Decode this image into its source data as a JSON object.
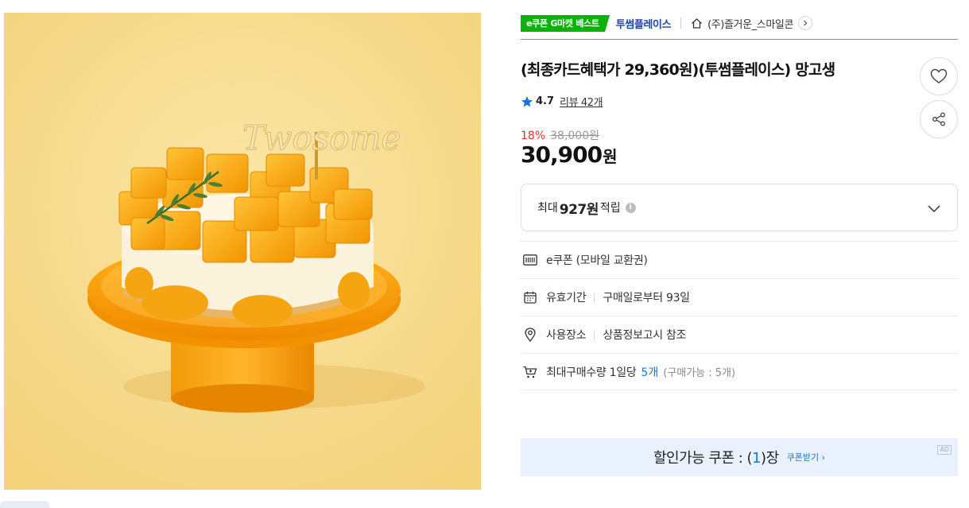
{
  "image": {
    "alt_subject": "mango mousse cake",
    "logo_text": "Twosome"
  },
  "breadcrumb": {
    "badge": "e쿠폰 G마켓 베스트",
    "brand": "투썸플레이스",
    "seller": "(주)즐거운_스마일콘"
  },
  "product": {
    "title": "(최종카드혜택가 29,360원)(투썸플레이스) 망고생",
    "rating": "4.7",
    "review_link": "리뷰 42개",
    "discount": "18%",
    "original_price": "38,000원",
    "sale_price": "30,900",
    "currency": "원"
  },
  "points": {
    "prefix": "최대",
    "value": "927원",
    "suffix": "적립",
    "info_mark": "i"
  },
  "specs": {
    "type": {
      "label": "e쿠폰 (모바일 교환권)"
    },
    "validity": {
      "label": "유효기간",
      "value": "구매일로부터 93일"
    },
    "location": {
      "label": "사용장소",
      "value": "상품정보고시 참조"
    },
    "limit": {
      "label": "최대구매수량 1일당",
      "value": "5개",
      "note": "(구매가능 : 5개)"
    }
  },
  "coupon": {
    "text_before": "할인가능 쿠폰 : (",
    "count": "1",
    "text_after": ")장",
    "link": "쿠폰받기 ›",
    "ad": "AD"
  },
  "colors": {
    "badge_green": "#0ab20a",
    "brand_blue": "#1a46b0",
    "discount_red": "#e62e2e",
    "link_blue": "#1a74d8",
    "coupon_bg": "#e9f1fc",
    "image_bg": "#f7dc8e"
  },
  "icons": [
    "home-icon",
    "chevron-right-icon",
    "heart-icon",
    "share-icon",
    "star-icon",
    "info-icon",
    "chevron-down-icon",
    "barcode-icon",
    "calendar-icon",
    "location-pin-icon",
    "cart-icon"
  ]
}
